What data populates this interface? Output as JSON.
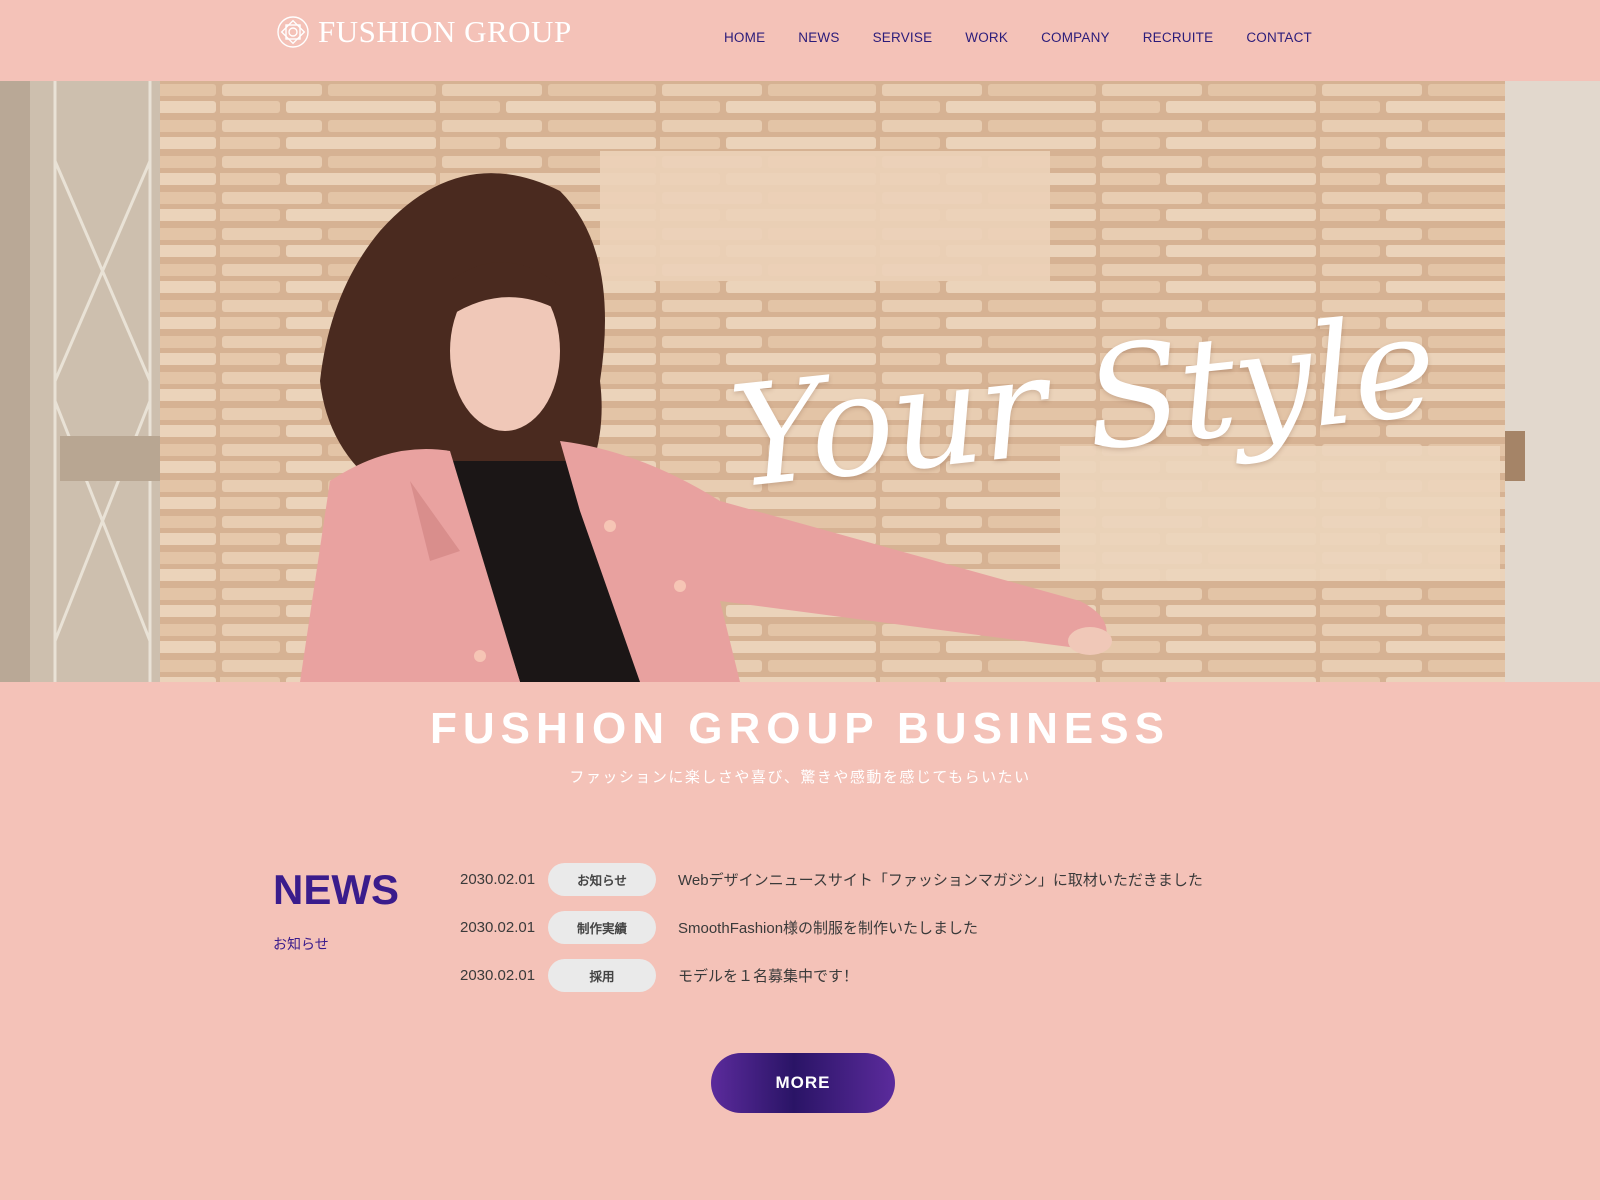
{
  "header": {
    "logo_text": "FUSHION GROUP",
    "nav": [
      "HOME",
      "NEWS",
      "SERVISE",
      "WORK",
      "COMPANY",
      "RECRUITE",
      "CONTACT"
    ]
  },
  "hero": {
    "script_text": "Your Style",
    "image_subject": "woman in pink coat against stone wall"
  },
  "business": {
    "title": "FUSHION GROUP BUSINESS",
    "subtitle": "ファッションに楽しさや喜び、驚きや感動を感じてもらいたい"
  },
  "news": {
    "heading": "NEWS",
    "subheading": "お知らせ",
    "items": [
      {
        "date": "2030.02.01",
        "tag": "お知らせ",
        "text": "Webデザインニュースサイト「ファッションマガジン」に取材いただきました"
      },
      {
        "date": "2030.02.01",
        "tag": "制作実績",
        "text": "SmoothFashion様の制服を制作いたしました"
      },
      {
        "date": "2030.02.01",
        "tag": "採用",
        "text": "モデルを１名募集中です！"
      }
    ],
    "more_label": "MORE"
  },
  "colors": {
    "background": "#f4c2b8",
    "accent": "#3a1c8c",
    "button_dark": "#2a1466",
    "button_light": "#5b2b9c"
  }
}
